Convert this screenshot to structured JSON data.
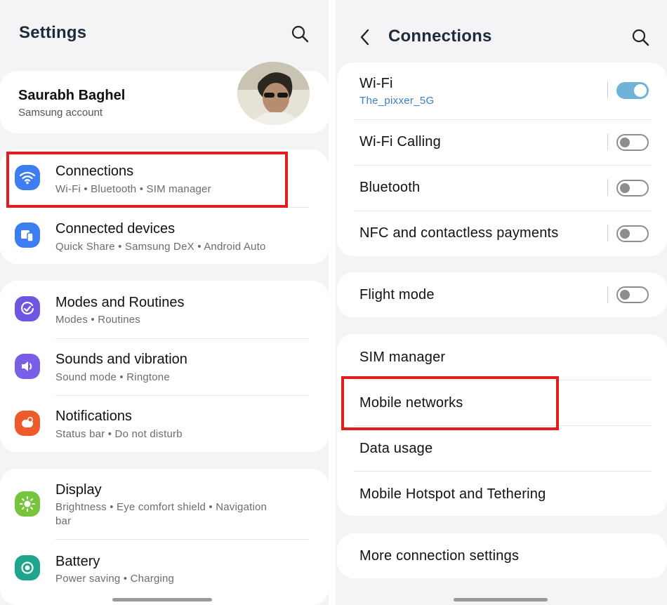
{
  "left": {
    "title": "Settings",
    "account": {
      "name": "Saurabh Baghel",
      "subtitle": "Samsung account"
    },
    "items": [
      {
        "title": "Connections",
        "subtitle": "Wi-Fi  •  Bluetooth  •  SIM manager",
        "icon": "wifi-icon",
        "color": "#3d7df2"
      },
      {
        "title": "Connected devices",
        "subtitle": "Quick Share  •  Samsung DeX  •  Android Auto",
        "icon": "connected-devices-icon",
        "color": "#3d7df2"
      },
      {
        "title": "Modes and Routines",
        "subtitle": "Modes  •  Routines",
        "icon": "check-circle-icon",
        "color": "#6f55e0"
      },
      {
        "title": "Sounds and vibration",
        "subtitle": "Sound mode  •  Ringtone",
        "icon": "speaker-icon",
        "color": "#7a5ee6"
      },
      {
        "title": "Notifications",
        "subtitle": "Status bar  •  Do not disturb",
        "icon": "bell-badge-icon",
        "color": "#ef5a2a"
      },
      {
        "title": "Display",
        "subtitle": "Brightness  •  Eye comfort shield  •  Navigation",
        "subtitle2": "bar",
        "icon": "sun-icon",
        "color": "#77c43d"
      },
      {
        "title": "Battery",
        "subtitle": "Power saving  •  Charging",
        "icon": "battery-icon",
        "color": "#1ea58b"
      }
    ]
  },
  "right": {
    "title": "Connections",
    "items": [
      {
        "title": "Wi-Fi",
        "subtitle": "The_pixxer_5G",
        "toggle": true
      },
      {
        "title": "Wi-Fi Calling",
        "toggle": false
      },
      {
        "title": "Bluetooth",
        "toggle": false
      },
      {
        "title": "NFC and contactless payments",
        "toggle": false
      },
      {
        "title": "Flight mode",
        "toggle": false
      },
      {
        "title": "SIM manager"
      },
      {
        "title": "Mobile networks"
      },
      {
        "title": "Data usage"
      },
      {
        "title": "Mobile Hotspot and Tethering"
      },
      {
        "title": "More connection settings"
      }
    ]
  },
  "colors": {
    "highlight": "#e61b1b",
    "toggle_on": "#6fb3d9",
    "wifi_ssid": "#3b7fc4"
  }
}
